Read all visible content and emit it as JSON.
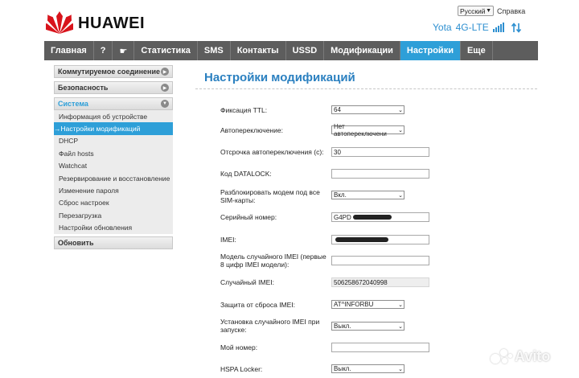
{
  "header": {
    "brand": "HUAWEI",
    "language": "Русский",
    "help": "Справка",
    "operator": "Yota",
    "network": "4G-LTE",
    "transfer_icon": "up-down-arrows-icon"
  },
  "nav": {
    "items": [
      {
        "label": "Главная",
        "name": "nav-home"
      },
      {
        "label": "?",
        "name": "nav-help"
      },
      {
        "label": "☛",
        "name": "nav-wizard"
      },
      {
        "label": "Статистика",
        "name": "nav-statistics"
      },
      {
        "label": "SMS",
        "name": "nav-sms"
      },
      {
        "label": "Контакты",
        "name": "nav-contacts"
      },
      {
        "label": "USSD",
        "name": "nav-ussd"
      },
      {
        "label": "Модификации",
        "name": "nav-modifications"
      },
      {
        "label": "Настройки",
        "name": "nav-settings",
        "active": true
      },
      {
        "label": "Еще",
        "name": "nav-more"
      }
    ],
    "active_color": "#2e9fd8"
  },
  "sidebar": {
    "dialup": "Коммутируемое соединение",
    "security": "Безопасность",
    "system": "Система",
    "system_items": [
      "Информация об устройстве",
      "→Настройки модификаций",
      "DHCP",
      "Файл hosts",
      "Watchcat",
      "Резервирование и восстановление",
      "Изменение пароля",
      "Сброс настроек",
      "Перезагрузка",
      "Настройки обновления"
    ],
    "update": "Обновить"
  },
  "content": {
    "title": "Настройки модификаций",
    "fields": {
      "ttl_label": "Фиксация TTL:",
      "ttl_value": "64",
      "autoswitch_label": "Автопереключение:",
      "autoswitch_value": "Нет автопереключени",
      "delay_label": "Отсрочка автопереключения (с):",
      "delay_value": "30",
      "datalock_label": "Код DATALOCK:",
      "datalock_value": "",
      "unlock_label": "Разблокировать модем под все SIM-карты:",
      "unlock_value": "Вкл.",
      "serial_label": "Серийный номер:",
      "serial_value": "G4PD",
      "imei_label": "IMEI:",
      "imei_value": "",
      "random_model_label": "Модель случайного IMEI (первые 8 цифр IMEI модели):",
      "random_model_value": "",
      "random_imei_label": "Случайный IMEI:",
      "random_imei_value": "506258672040998",
      "reset_protect_label": "Защита от сброса IMEI:",
      "reset_protect_value": "AT^INFORBU",
      "install_random_label": "Установка случайного IMEI при запуске:",
      "install_random_value": "Выкл.",
      "my_number_label": "Мой номер:",
      "my_number_value": "",
      "hspa_label": "HSPA Locker:",
      "hspa_value": "Выкл."
    }
  },
  "watermark": "Avito"
}
